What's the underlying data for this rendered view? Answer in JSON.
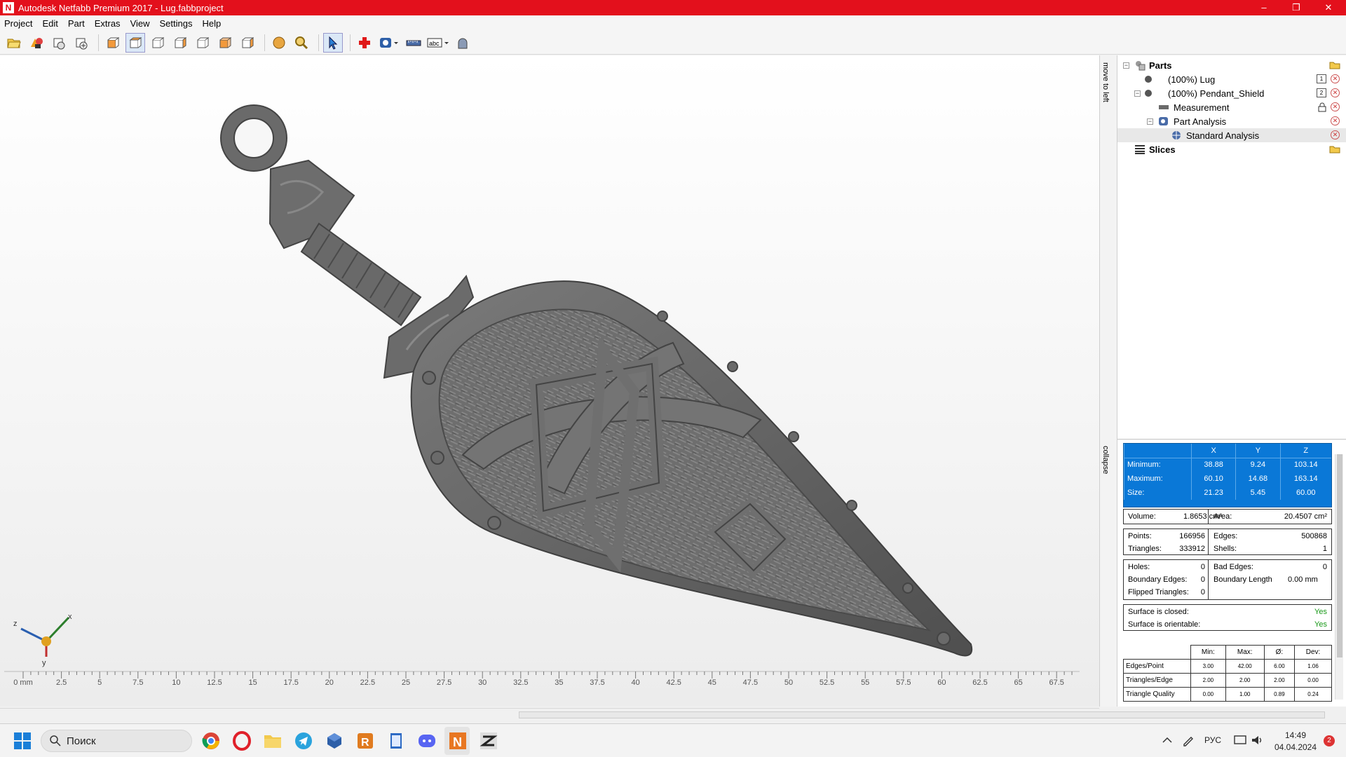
{
  "window": {
    "title": "Autodesk Netfabb Premium 2017 - Lug.fabbproject",
    "app_icon_letter": "N",
    "controls": [
      "–",
      "❐",
      "✕"
    ]
  },
  "menu": [
    "Project",
    "Edit",
    "Part",
    "Extras",
    "View",
    "Settings",
    "Help"
  ],
  "side_tabs": {
    "move": "move to left",
    "collapse": "collapse"
  },
  "tree": {
    "parts": "Parts",
    "lug": "(100%) Lug",
    "lug_badge": "1",
    "pendant": "(100%) Pendant_Shield",
    "pendant_badge": "2",
    "measurement": "Measurement",
    "part_analysis": "Part Analysis",
    "standard_analysis": "Standard Analysis",
    "slices": "Slices"
  },
  "bbox": {
    "headers": [
      "",
      "X",
      "Y",
      "Z"
    ],
    "rows": [
      {
        "label": "Minimum:",
        "x": "38.88",
        "y": "9.24",
        "z": "103.14"
      },
      {
        "label": "Maximum:",
        "x": "60.10",
        "y": "14.68",
        "z": "163.14"
      },
      {
        "label": "Size:",
        "x": "21.23",
        "y": "5.45",
        "z": "60.00"
      }
    ]
  },
  "stats": {
    "volume_label": "Volume:",
    "volume": "1.8653 cm³",
    "area_label": "Area:",
    "area": "20.4507 cm²",
    "points_label": "Points:",
    "points": "166956",
    "edges_label": "Edges:",
    "edges": "500868",
    "triangles_label": "Triangles:",
    "triangles": "333912",
    "shells_label": "Shells:",
    "shells": "1",
    "holes_label": "Holes:",
    "holes": "0",
    "bad_edges_label": "Bad Edges:",
    "bad_edges": "0",
    "boundary_edges_label": "Boundary Edges:",
    "boundary_edges": "0",
    "boundary_length_label": "Boundary Length",
    "boundary_length": "0.00 mm",
    "flipped_label": "Flipped Triangles:",
    "flipped": "0",
    "closed_label": "Surface is closed:",
    "closed": "Yes",
    "orientable_label": "Surface is orientable:",
    "orientable": "Yes"
  },
  "quality": {
    "headers": [
      "",
      "Min:",
      "Max:",
      "Ø:",
      "Dev:"
    ],
    "rows": [
      {
        "label": "Edges/Point",
        "min": "3.00",
        "max": "42.00",
        "avg": "6.00",
        "dev": "1.06"
      },
      {
        "label": "Triangles/Edge",
        "min": "2.00",
        "max": "2.00",
        "avg": "2.00",
        "dev": "0.00"
      },
      {
        "label": "Triangle Quality",
        "min": "0.00",
        "max": "1.00",
        "avg": "0.89",
        "dev": "0.24"
      }
    ]
  },
  "axes": {
    "x": "x",
    "y": "y",
    "z": "z"
  },
  "ruler": {
    "labels": [
      "0 mm",
      "2.5",
      "5",
      "7.5",
      "10",
      "12.5",
      "15",
      "17.5",
      "20",
      "22.5",
      "25",
      "27.5",
      "30",
      "32.5",
      "35",
      "37.5",
      "40",
      "42.5",
      "45",
      "47.5",
      "50",
      "52.5",
      "55",
      "57.5",
      "60",
      "62.5",
      "65",
      "67.5"
    ]
  },
  "taskbar": {
    "search_placeholder": "Поиск",
    "lang": "РУС",
    "time": "14:49",
    "date": "04.04.2024",
    "notifications": "2"
  },
  "colors": {
    "title_bar": "#e3101c",
    "bbox_bg": "#0a78d7",
    "model": "#6b6b6b",
    "yes": "#1a9a1a"
  }
}
